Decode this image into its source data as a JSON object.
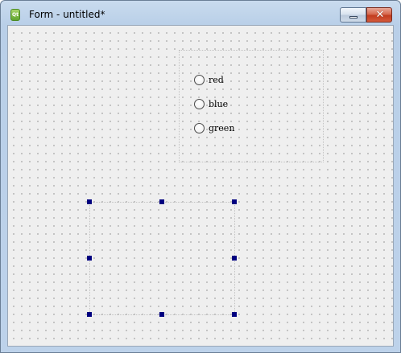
{
  "window": {
    "title": "Form - untitled*",
    "app_icon_text": "Qt",
    "close_glyph": "✕"
  },
  "radio_group": {
    "options": [
      {
        "label": "red",
        "checked": false
      },
      {
        "label": "blue",
        "checked": false
      },
      {
        "label": "green",
        "checked": false
      }
    ]
  },
  "colors": {
    "selection_handle": "#000080",
    "close_button": "#c23c1f",
    "form_background": "#efefef"
  },
  "icons": {
    "app_icon": "qt-designer-icon",
    "minimize": "minimize-icon",
    "close": "close-icon"
  }
}
